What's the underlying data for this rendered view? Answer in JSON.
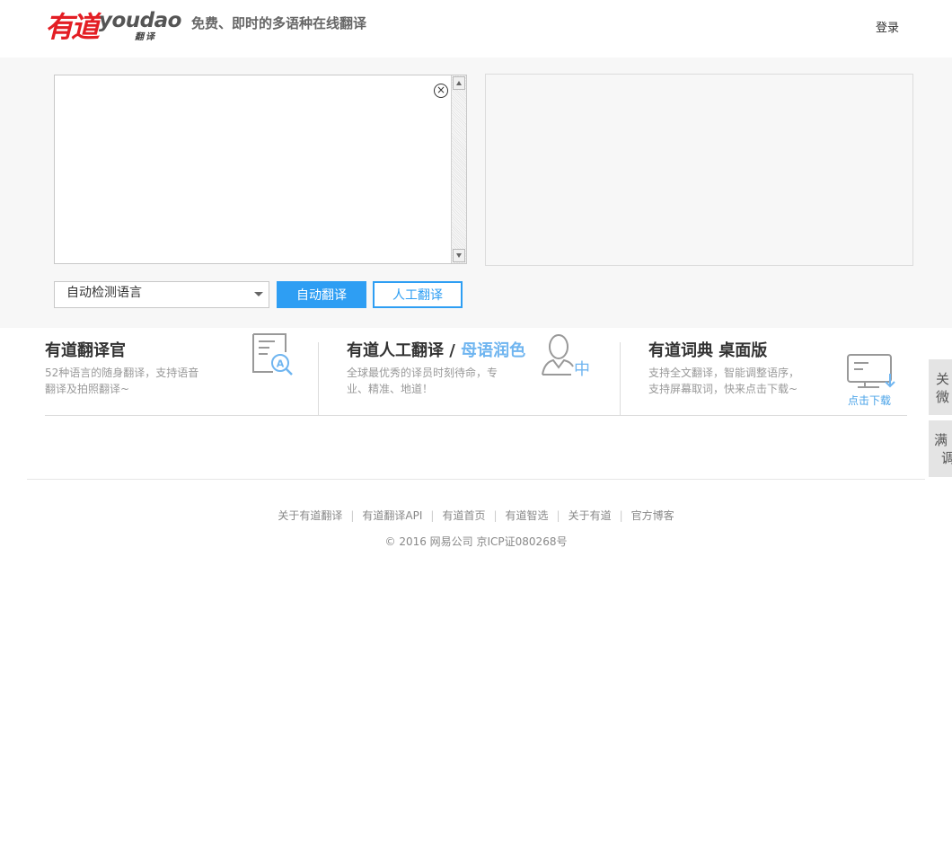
{
  "header": {
    "logo_cn": "有道",
    "logo_en": "youdao",
    "logo_sub": "翻译",
    "slogan": "免费、即时的多语种在线翻译",
    "login_label": "登录"
  },
  "translator": {
    "input_value": "",
    "output_text": "",
    "language_select": "自动检测语言",
    "auto_translate_label": "自动翻译",
    "human_translate_label": "人工翻译",
    "clear_icon": "close-circle-icon"
  },
  "products": [
    {
      "title": "有道翻译官",
      "description_line1": "52种语言的随身翻译，支持语音",
      "description_line2": "翻译及拍照翻译~",
      "icon": "document-search-icon"
    },
    {
      "title_prefix": "有道人工翻译 / ",
      "title_highlight": "母语润色",
      "description_line1": "全球最优秀的译员时刻待命，专",
      "description_line2": "业、精准、地道！",
      "icon": "person-chinese-icon",
      "icon_text": "中"
    },
    {
      "title": "有道词典 桌面版",
      "description_line1": "支持全文翻译，智能调整语序，",
      "description_line2": "支持屏幕取词，快来点击下载~",
      "icon": "monitor-download-icon",
      "download_label": "点击下载"
    }
  ],
  "side_tabs": [
    {
      "line1": "关",
      "line2": "微"
    },
    {
      "line1": "满",
      "line2": "调"
    }
  ],
  "footer": {
    "links": [
      "关于有道翻译",
      "有道翻译API",
      "有道首页",
      "有道智选",
      "关于有道",
      "官方博客"
    ],
    "separator": "|",
    "copyright": "© 2016 网易公司 京ICP证080268号"
  },
  "colors": {
    "brand_red": "#e31e24",
    "accent_blue": "#2e9ef3",
    "highlight_blue": "#6fb5f0"
  }
}
